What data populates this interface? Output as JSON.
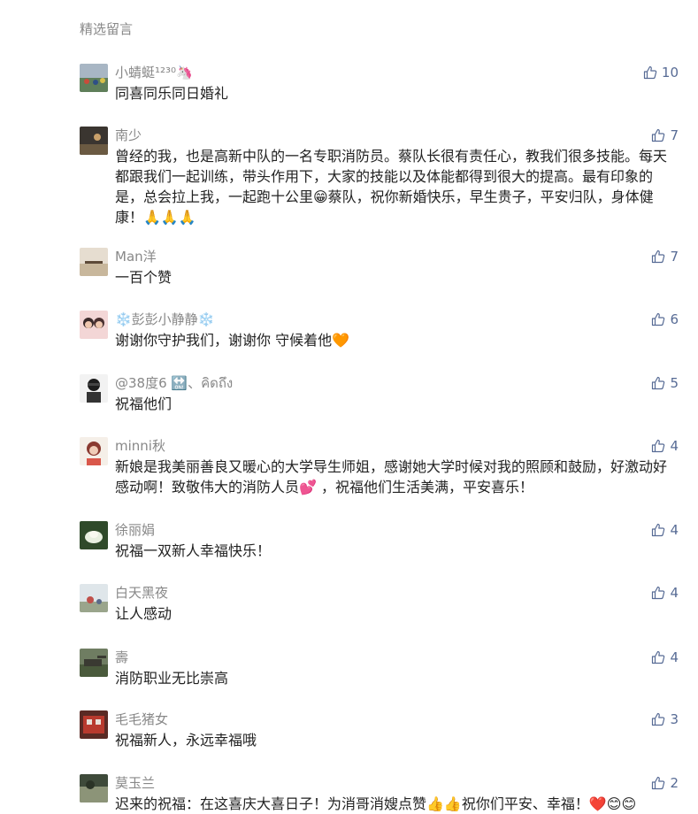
{
  "section_title": "精选留言",
  "comments": [
    {
      "name": "小蜻蜓¹²³⁰🦄",
      "content": "同喜同乐同日婚礼",
      "likes": "10"
    },
    {
      "name": "南少",
      "content": "曾经的我，也是高新中队的一名专职消防员。蔡队长很有责任心，教我们很多技能。每天都跟我们一起训练，带头作用下，大家的技能以及体能都得到很大的提高。最有印象的是，总会拉上我，一起跑十公里😁蔡队，祝你新婚快乐，早生贵子，平安归队，身体健康！🙏🙏🙏",
      "likes": "7"
    },
    {
      "name": "Man洋",
      "content": "一百个赞",
      "likes": "7"
    },
    {
      "name": "❄️彭彭小静静❄️",
      "content": "谢谢你守护我们，谢谢你 守候着他🧡",
      "likes": "6"
    },
    {
      "name": "@38度6 🔛、คิดถึง",
      "content": "祝福他们",
      "likes": "5"
    },
    {
      "name": "minni秋",
      "content": "新娘是我美丽善良又暖心的大学导生师姐，感谢她大学时候对我的照顾和鼓励，好激动好感动啊！致敬伟大的消防人员💕 ，祝福他们生活美满，平安喜乐！",
      "likes": "4"
    },
    {
      "name": "徐丽娟",
      "content": "祝福一双新人幸福快乐！",
      "likes": "4"
    },
    {
      "name": "白天黑夜",
      "content": "让人感动",
      "likes": "4"
    },
    {
      "name": "壽",
      "content": "消防职业无比崇高",
      "likes": "4"
    },
    {
      "name": "毛毛猪女",
      "content": "祝福新人，永远幸福哦",
      "likes": "3"
    },
    {
      "name": "莫玉兰",
      "content": "迟来的祝福：在这喜庆大喜日子！为消哥消嫂点赞👍👍祝你们平安、幸福！❤️😊😊",
      "likes": "2"
    }
  ],
  "icons": {
    "like": "thumbs-up-icon"
  },
  "colors": {
    "like": "#576b95",
    "name": "#888888",
    "text": "#222222"
  }
}
